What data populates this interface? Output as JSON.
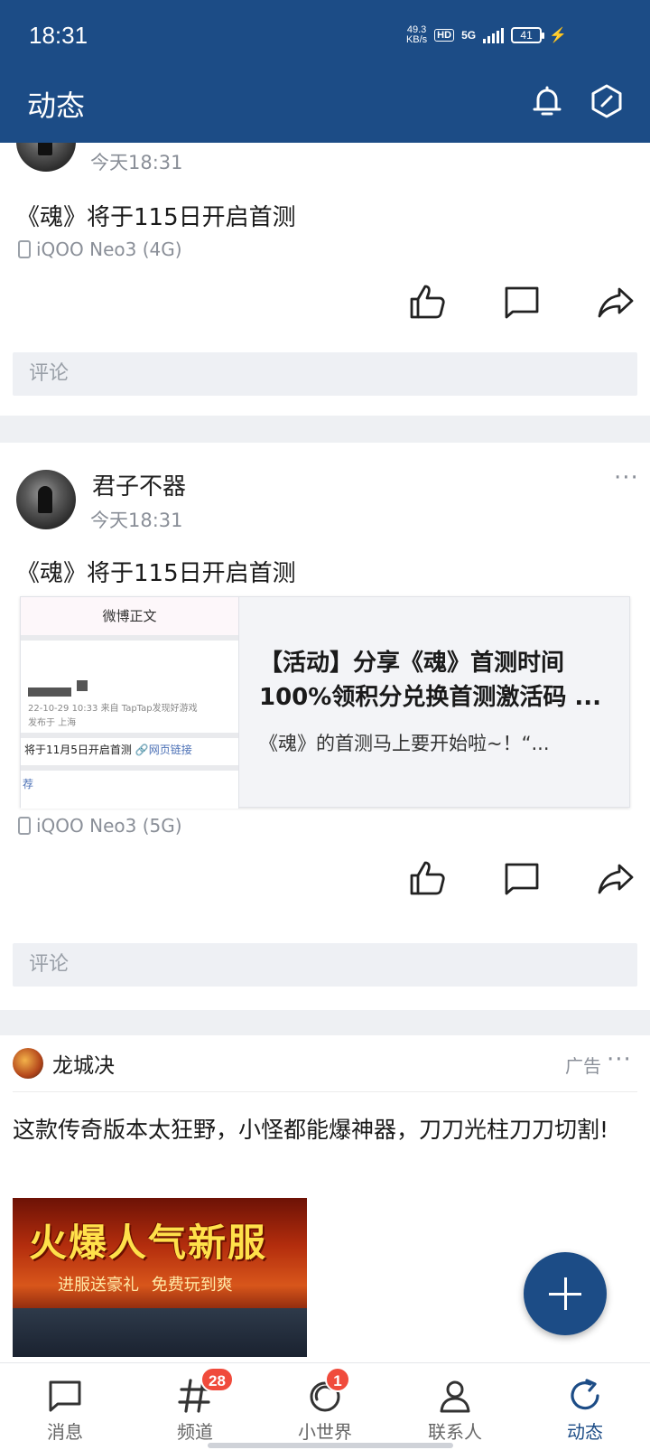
{
  "status_bar": {
    "time": "18:31",
    "net_speed_value": "49.3",
    "net_speed_unit": "KB/s",
    "hd": "HD",
    "network": "5G",
    "battery": "41"
  },
  "app_bar": {
    "title": "动态"
  },
  "post1": {
    "timestamp": "今天18:31",
    "text": "《魂》将于115日开启首测",
    "device": "iQOO Neo3 (4G)",
    "comment_placeholder": "评论"
  },
  "post2": {
    "username": "君子不器",
    "timestamp": "今天18:31",
    "text": "《魂》将于115日开启首测",
    "share": {
      "thumb_header": "微博正文",
      "thumb_date": "22-10-29 10:33  来自 TapTap发现好游戏",
      "thumb_place": "发布于 上海",
      "thumb_text": "将于11月5日开启首测",
      "thumb_link": "网页链接",
      "thumb_more": "荐",
      "title_line1": "【活动】分享《魂》首测时间",
      "title_line2": "100%领积分兑换首测激活码 ...",
      "desc": "《魂》的首测马上要开始啦~！“..."
    },
    "device": "iQOO Neo3 (5G)",
    "comment_placeholder": "评论"
  },
  "ad": {
    "name": "龙城决",
    "tag": "广告",
    "text": "这款传奇版本太狂野，小怪都能爆神器，刀刀光柱刀刀切割!",
    "image_title": "火爆人气新服",
    "image_subtitle": "进服送豪礼    免费玩到爽"
  },
  "bottom_nav": {
    "tabs": [
      {
        "label": "消息",
        "icon": "message-icon"
      },
      {
        "label": "频道",
        "icon": "hashtag-icon",
        "badge": "28"
      },
      {
        "label": "小世界",
        "icon": "planet-icon",
        "badge": "1"
      },
      {
        "label": "联系人",
        "icon": "contacts-icon"
      },
      {
        "label": "动态",
        "icon": "refresh-icon",
        "active": true
      }
    ]
  },
  "colors": {
    "primary": "#1c4c86",
    "badge": "#f04b3c",
    "muted": "#8a8f98"
  }
}
